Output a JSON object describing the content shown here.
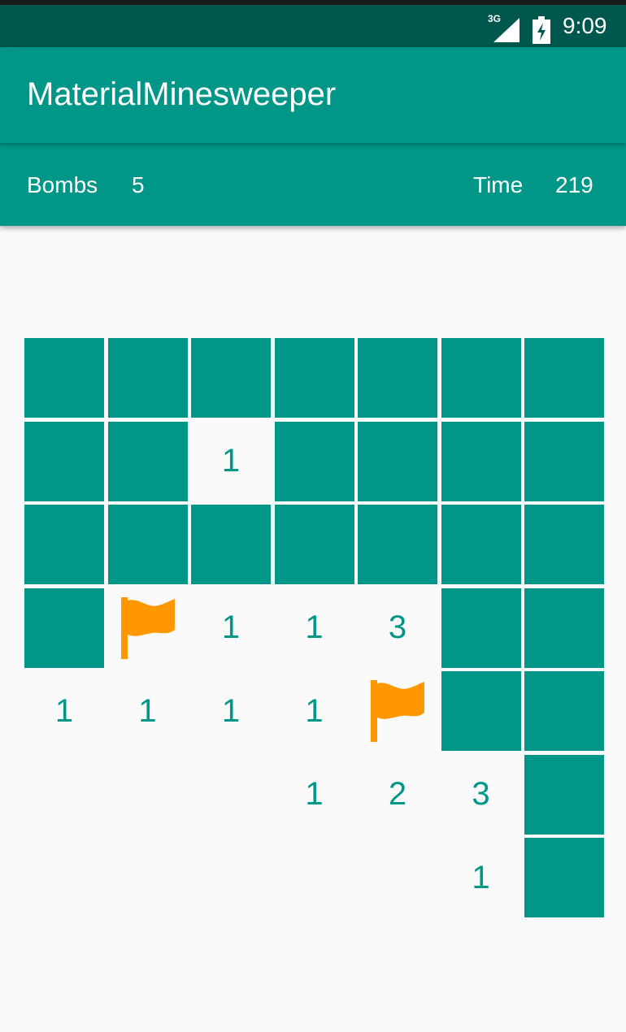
{
  "status_bar": {
    "network": "3G",
    "time": "9:09"
  },
  "app": {
    "title": "MaterialMinesweeper"
  },
  "info": {
    "bombs_label": "Bombs",
    "bombs_value": "5",
    "time_label": "Time",
    "time_value": "219"
  },
  "colors": {
    "primary": "#009688",
    "primary_dark": "#00574d",
    "flag": "#ff9800",
    "background": "#fafafa"
  },
  "board": {
    "rows": 7,
    "cols": 7,
    "legend": "C = covered cell, F = flagged cell, digit = revealed count, empty = revealed blank",
    "cells": [
      [
        "C",
        "C",
        "C",
        "C",
        "C",
        "C",
        "C"
      ],
      [
        "C",
        "C",
        "1",
        "C",
        "C",
        "C",
        "C"
      ],
      [
        "C",
        "C",
        "C",
        "C",
        "C",
        "C",
        "C"
      ],
      [
        "C",
        "F",
        "1",
        "1",
        "3",
        "C",
        "C"
      ],
      [
        "1",
        "1",
        "1",
        "1",
        "F",
        "C",
        "C"
      ],
      [
        "",
        "",
        "",
        "1",
        "2",
        "3",
        "C"
      ],
      [
        "",
        "",
        "",
        "",
        "",
        "1",
        "C"
      ]
    ]
  }
}
